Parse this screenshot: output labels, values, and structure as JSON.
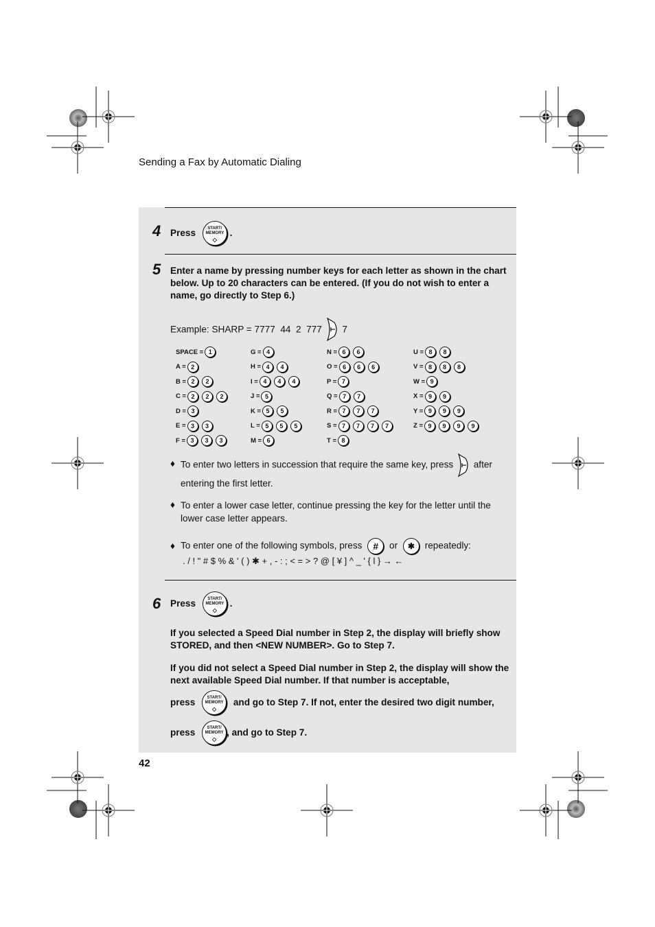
{
  "header": {
    "title": "Sending a Fax by Automatic Dialing"
  },
  "page_number": "42",
  "start_button": {
    "line1": "START/",
    "line2": "MEMORY",
    "icon": "start-diamond-icon"
  },
  "step4": {
    "number": "4",
    "press": "Press",
    "period": "."
  },
  "step5": {
    "number": "5",
    "text": "Enter a name by pressing number keys for each letter as shown in the chart below. Up to 20 characters can be entered. (If you do not wish to enter a name, go directly to Step 6.)",
    "example_prefix": "Example: SHARP = 7777  44  2  777",
    "example_suffix": "7",
    "chart": {
      "columns": [
        [
          {
            "label": "SPACE =",
            "keys": [
              "1"
            ]
          },
          {
            "label": "A =",
            "keys": [
              "2"
            ]
          },
          {
            "label": "B =",
            "keys": [
              "2",
              "2"
            ]
          },
          {
            "label": "C =",
            "keys": [
              "2",
              "2",
              "2"
            ]
          },
          {
            "label": "D =",
            "keys": [
              "3"
            ]
          },
          {
            "label": "E =",
            "keys": [
              "3",
              "3"
            ]
          },
          {
            "label": "F =",
            "keys": [
              "3",
              "3",
              "3"
            ]
          }
        ],
        [
          {
            "label": "G =",
            "keys": [
              "4"
            ]
          },
          {
            "label": "H =",
            "keys": [
              "4",
              "4"
            ]
          },
          {
            "label": "I  =",
            "keys": [
              "4",
              "4",
              "4"
            ]
          },
          {
            "label": "J =",
            "keys": [
              "5"
            ]
          },
          {
            "label": "K =",
            "keys": [
              "5",
              "5"
            ]
          },
          {
            "label": "L =",
            "keys": [
              "5",
              "5",
              "5"
            ]
          },
          {
            "label": "M =",
            "keys": [
              "6"
            ]
          }
        ],
        [
          {
            "label": "N =",
            "keys": [
              "6",
              "6"
            ]
          },
          {
            "label": "O =",
            "keys": [
              "6",
              "6",
              "6"
            ]
          },
          {
            "label": "P =",
            "keys": [
              "7"
            ]
          },
          {
            "label": "Q =",
            "keys": [
              "7",
              "7"
            ]
          },
          {
            "label": "R =",
            "keys": [
              "7",
              "7",
              "7"
            ]
          },
          {
            "label": "S =",
            "keys": [
              "7",
              "7",
              "7",
              "7"
            ]
          },
          {
            "label": "T =",
            "keys": [
              "8"
            ]
          }
        ],
        [
          {
            "label": "U =",
            "keys": [
              "8",
              "8"
            ]
          },
          {
            "label": "V =",
            "keys": [
              "8",
              "8",
              "8"
            ]
          },
          {
            "label": "W =",
            "keys": [
              "9"
            ]
          },
          {
            "label": "X =",
            "keys": [
              "9",
              "9"
            ]
          },
          {
            "label": "Y =",
            "keys": [
              "9",
              "9",
              "9"
            ]
          },
          {
            "label": "Z =",
            "keys": [
              "9",
              "9",
              "9",
              "9"
            ]
          }
        ]
      ]
    },
    "bullets": {
      "marker": "♦",
      "b1_part1": "To enter two letters in succession that require the same key, press",
      "b1_part2": "after",
      "b1_line2": "entering the first letter.",
      "b2": "To enter a lower case letter, continue pressing the key for the letter until the lower case letter appears.",
      "b3_part1": "To enter one of the following symbols, press",
      "b3_or": "or",
      "b3_part2": "repeatedly:",
      "hash_key": "#",
      "star_key": "✱",
      "symbols": ". / ! \" # $ % & ' ( ) ✱ + , - : ; < = > ? @ [ ¥ ] ^ _ ' { l } → ←"
    }
  },
  "step6": {
    "number": "6",
    "press": "Press",
    "period": ".",
    "para1": "If you  selected a Speed Dial number in Step 2, the display will briefly show STORED, and then <NEW NUMBER>. Go to Step 7.",
    "para2": "If you did not select a Speed Dial number in Step 2, the display will show the next available Speed Dial number. If that number is acceptable,",
    "press_lower": "press",
    "line3_after": "and go to Step 7. If not, enter the desired two digit number,",
    "line4_after": ", and go to Step 7."
  }
}
